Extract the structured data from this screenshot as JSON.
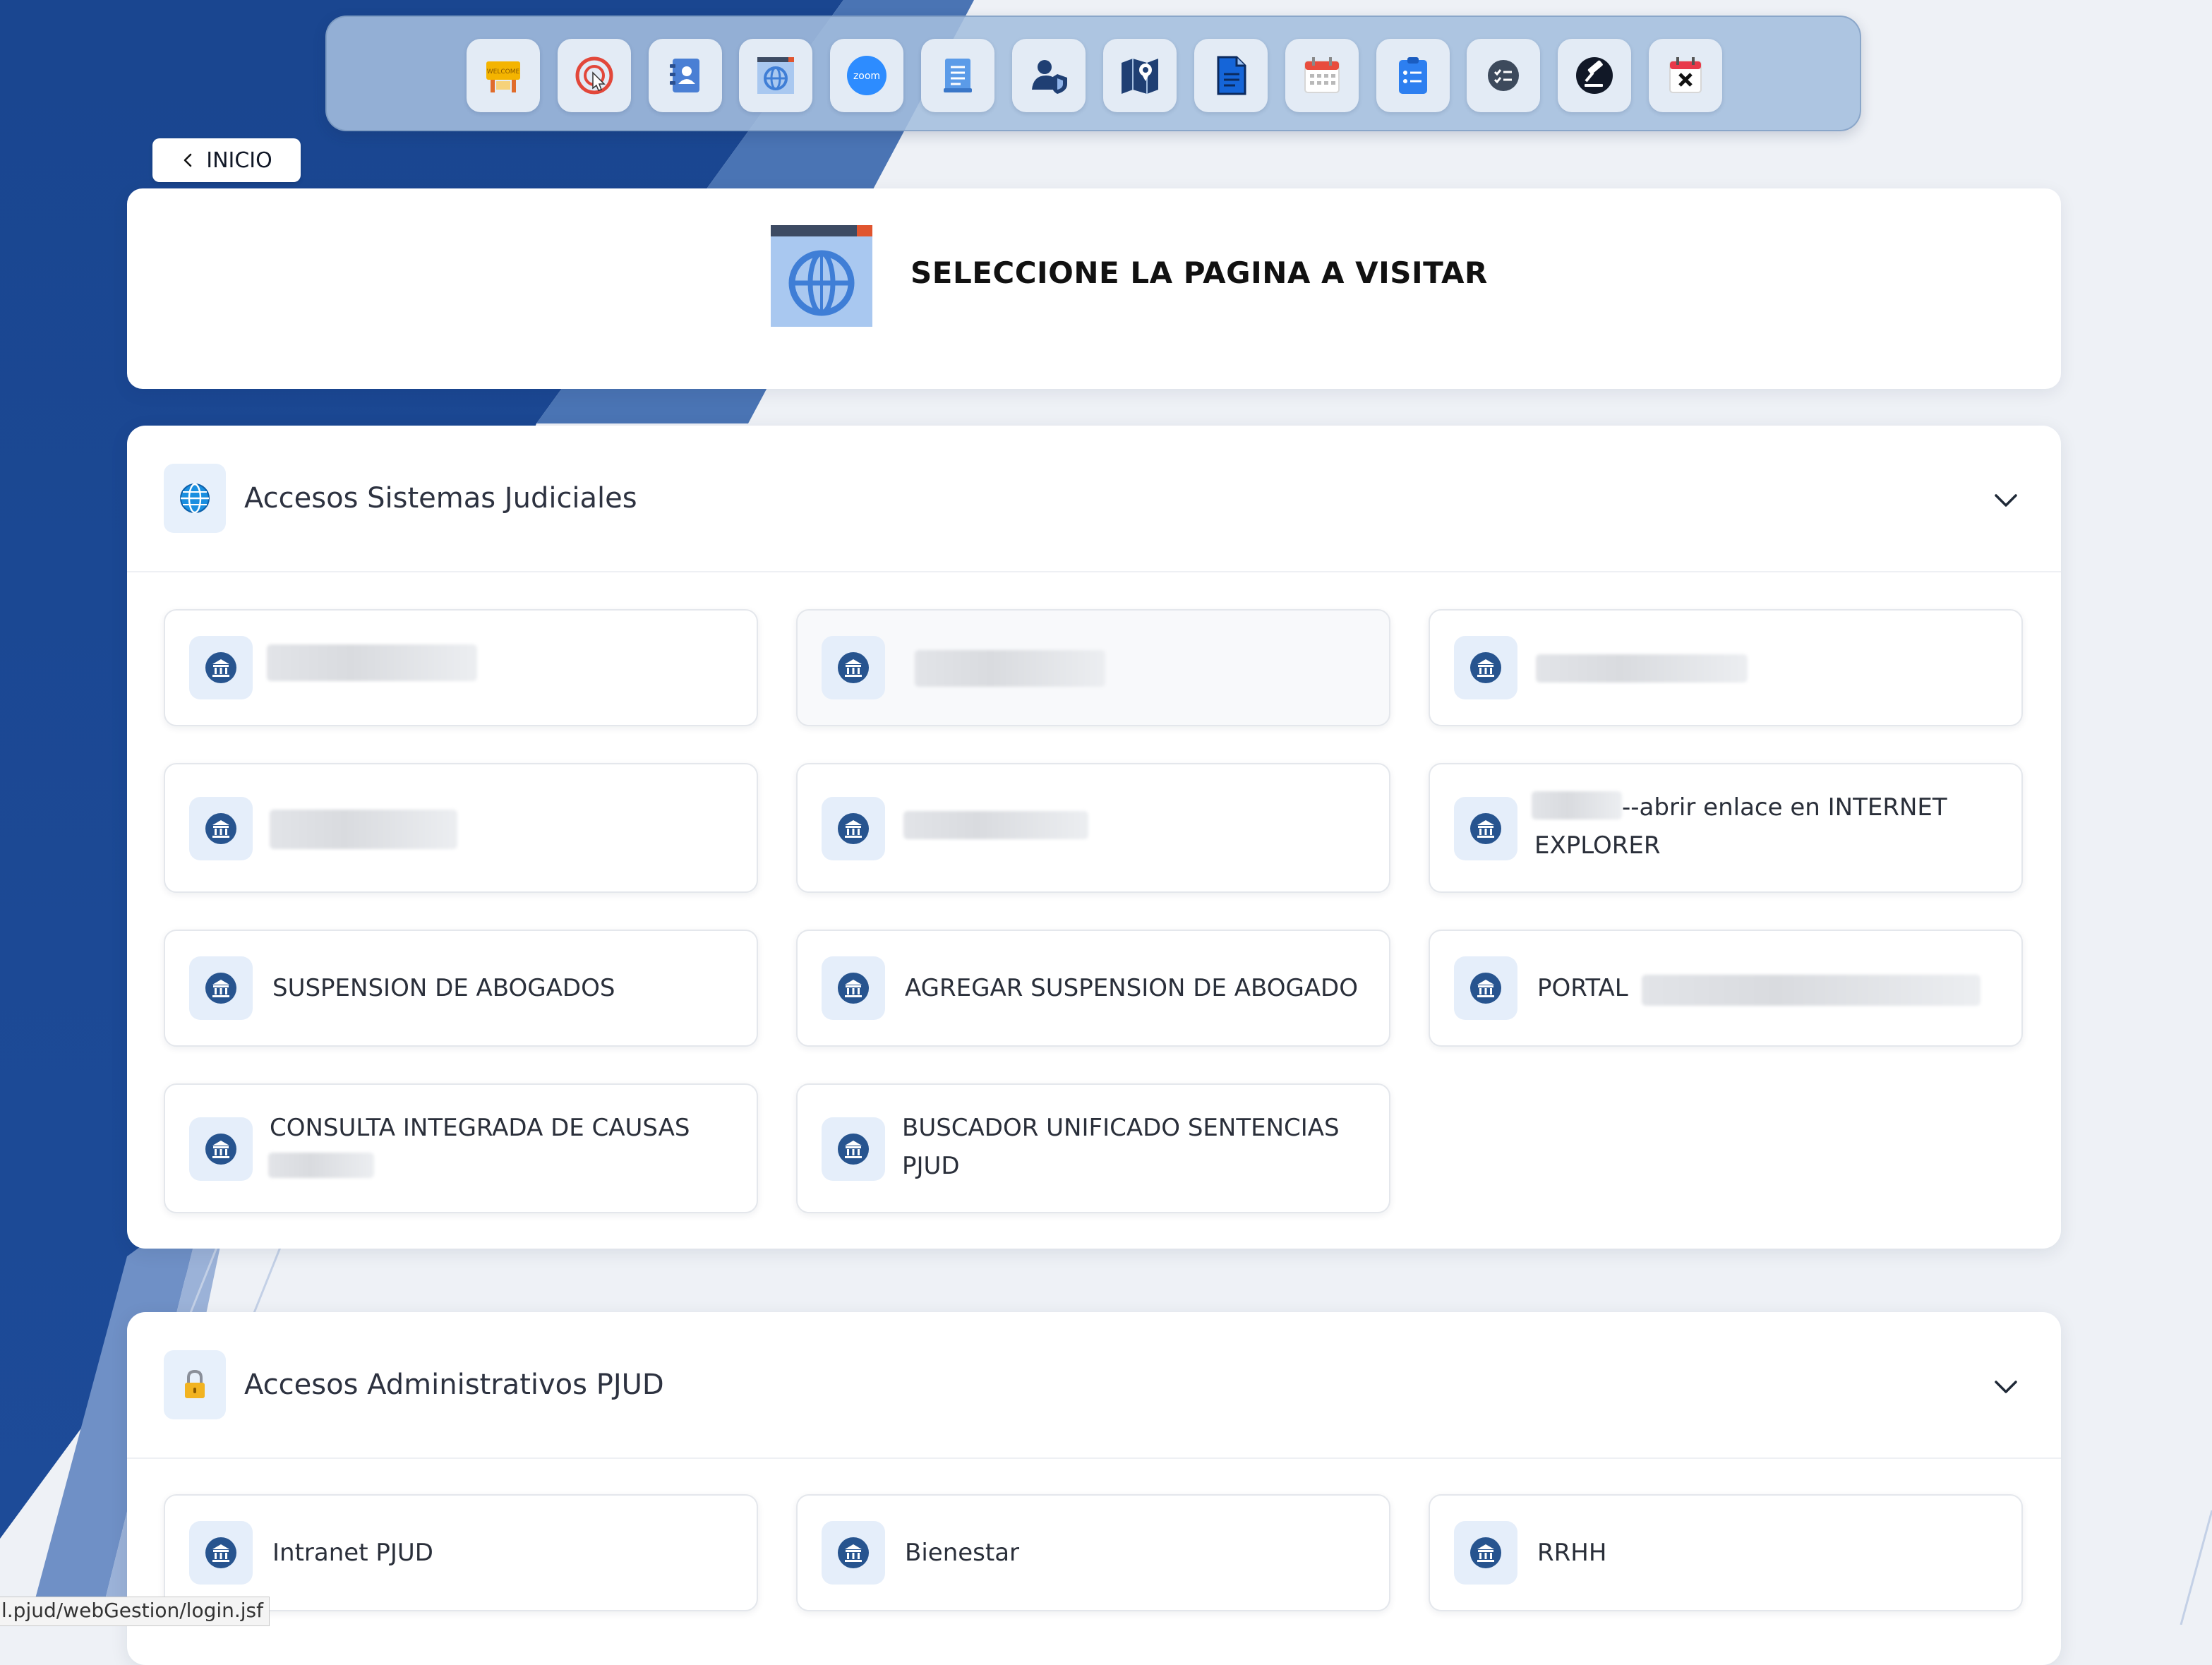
{
  "nav": {
    "back_label": "INICIO"
  },
  "dock": {
    "icons": [
      "welcome-icon",
      "cursor-click-icon",
      "contacts-book-icon",
      "web-browser-icon",
      "zoom-icon",
      "document-list-icon",
      "user-shield-icon",
      "map-pin-icon",
      "document-icon",
      "calendar-icon",
      "clipboard-list-icon",
      "checklist-icon",
      "gavel-icon",
      "calendar-cancel-icon"
    ],
    "zoom_text": "zoom"
  },
  "header": {
    "title": "SELECCIONE LA PAGINA A VISITAR"
  },
  "sections": [
    {
      "title": "Accesos Sistemas Judiciales",
      "icon": "globe-icon",
      "links": [
        {
          "label": ""
        },
        {
          "label": ""
        },
        {
          "label": ""
        },
        {
          "label": ""
        },
        {
          "label": ""
        },
        {
          "label": "--abrir enlace en INTERNET EXPLORER"
        },
        {
          "label": "SUSPENSION DE ABOGADOS"
        },
        {
          "label": "AGREGAR SUSPENSION DE ABOGADO"
        },
        {
          "label": "PORTAL"
        },
        {
          "label": "CONSULTA INTEGRADA DE CAUSAS"
        },
        {
          "label": "BUSCADOR UNIFICADO SENTENCIAS PJUD"
        }
      ]
    },
    {
      "title": "Accesos Administrativos PJUD",
      "icon": "lock-icon",
      "links": [
        {
          "label": "Intranet PJUD"
        },
        {
          "label": "Bienestar"
        },
        {
          "label": "RRHH"
        }
      ]
    }
  ],
  "status_bar": {
    "url": "l.pjud/webGestion/login.jsf"
  },
  "colors": {
    "accent_blue": "#1e4f99",
    "icon_tile": "#e5eefa",
    "page_bg": "#eef1f6"
  }
}
